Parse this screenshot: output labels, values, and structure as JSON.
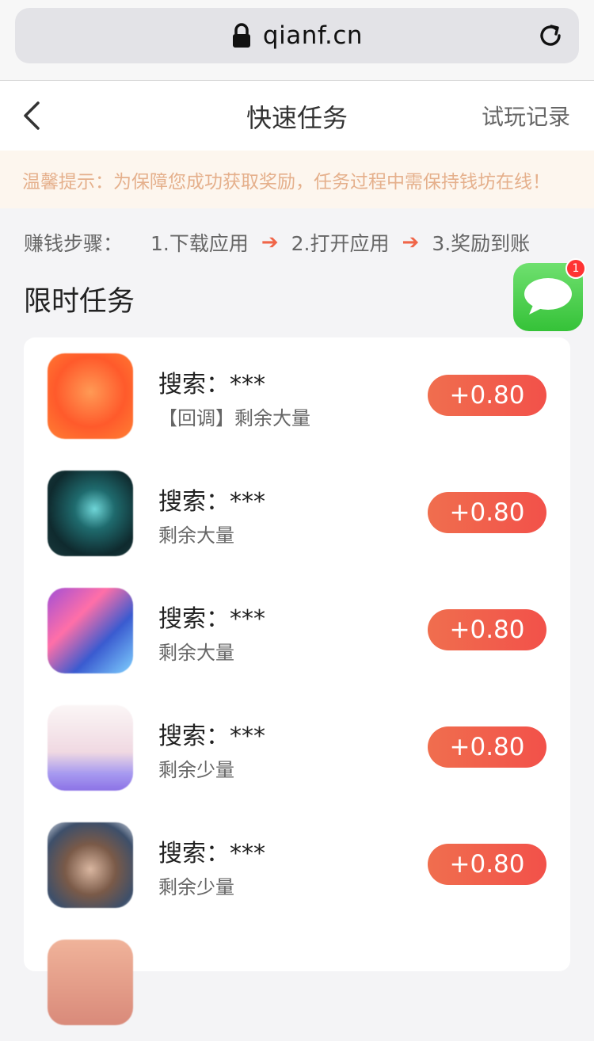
{
  "browser": {
    "url": "qianf.cn"
  },
  "header": {
    "title": "快速任务",
    "right_link": "试玩记录"
  },
  "notice": {
    "text": "温馨提示：为保障您成功获取奖励，任务过程中需保持钱坊在线！"
  },
  "steps": {
    "label": "赚钱步骤：",
    "items": [
      "1.下载应用",
      "2.打开应用",
      "3.奖励到账"
    ],
    "arrow": "➔"
  },
  "section": {
    "title": "限时任务"
  },
  "chat": {
    "badge_count": "1"
  },
  "tasks": [
    {
      "name": "搜索：***",
      "remaining": "【回调】剩余大量",
      "reward": "+0.80"
    },
    {
      "name": "搜索：***",
      "remaining": "剩余大量",
      "reward": "+0.80"
    },
    {
      "name": "搜索：***",
      "remaining": "剩余大量",
      "reward": "+0.80"
    },
    {
      "name": "搜索：***",
      "remaining": "剩余少量",
      "reward": "+0.80"
    },
    {
      "name": "搜索：***",
      "remaining": "剩余少量",
      "reward": "+0.80"
    }
  ],
  "colors": {
    "accent": "#f2514a",
    "notice_text": "#e5b08c",
    "notice_bg": "#fdf6ee"
  }
}
